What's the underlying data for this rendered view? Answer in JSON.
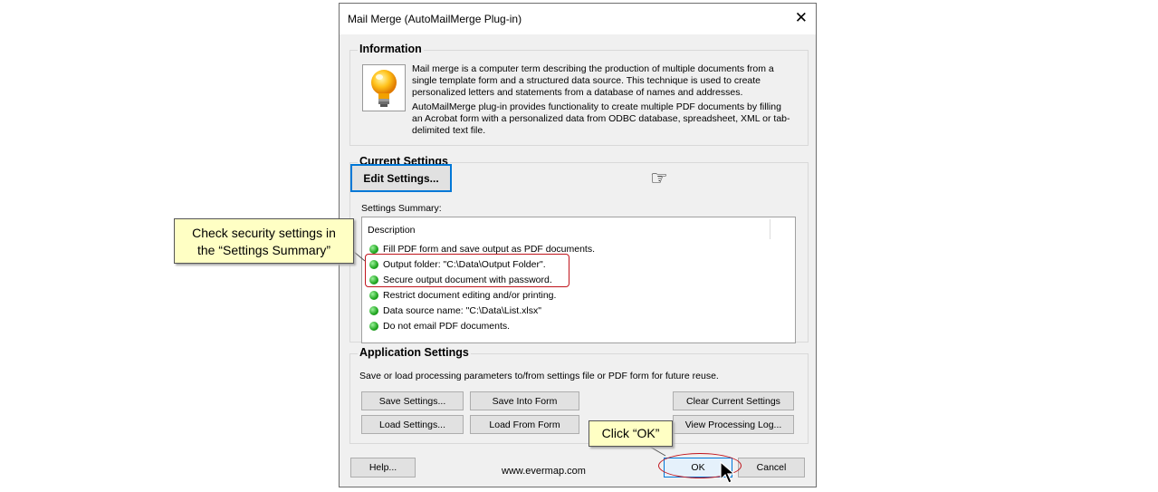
{
  "window": {
    "title": "Mail Merge (AutoMailMerge Plug-in)",
    "close_glyph": "✕"
  },
  "information": {
    "title": "Information",
    "paragraph1": "Mail merge is a computer term describing the production of multiple documents from a single template form and a structured data source. This technique is used to create personalized letters and statements from a database of names and addresses.",
    "paragraph2": "AutoMailMerge plug-in provides functionality to create multiple PDF documents by filling an Acrobat form with a personalized data from ODBC database, spreadsheet, XML or tab-delimited text file.",
    "icon": "lightbulb-icon"
  },
  "current_settings": {
    "title": "Current Settings",
    "summary_label": "Settings Summary:",
    "edit_button": "Edit Settings...",
    "hand_glyph": "☞",
    "column_header": "Description",
    "items": [
      "Fill PDF form and save output as PDF documents.",
      "Output folder: \"C:\\Data\\Output Folder\".",
      "Secure output document with password.",
      "Restrict document editing and/or printing.",
      "Data source name: \"C:\\Data\\List.xlsx\"",
      "Do not email PDF documents."
    ],
    "status_color": "#1fa51f"
  },
  "application_settings": {
    "title": "Application Settings",
    "description": "Save or load processing parameters to/from settings file or PDF form for future reuse.",
    "save_settings": "Save Settings...",
    "save_into_form": "Save Into Form",
    "clear_current_settings": "Clear Current Settings",
    "load_settings": "Load Settings...",
    "load_from_form": "Load From Form",
    "view_processing_log": "View Processing Log..."
  },
  "footer": {
    "help": "Help...",
    "website": "www.evermap.com",
    "ok": "OK",
    "cancel": "Cancel"
  },
  "callouts": {
    "security": "Check security settings in the “Settings Summary”",
    "ok": "Click “OK”"
  },
  "highlight_color": "#c0141c"
}
